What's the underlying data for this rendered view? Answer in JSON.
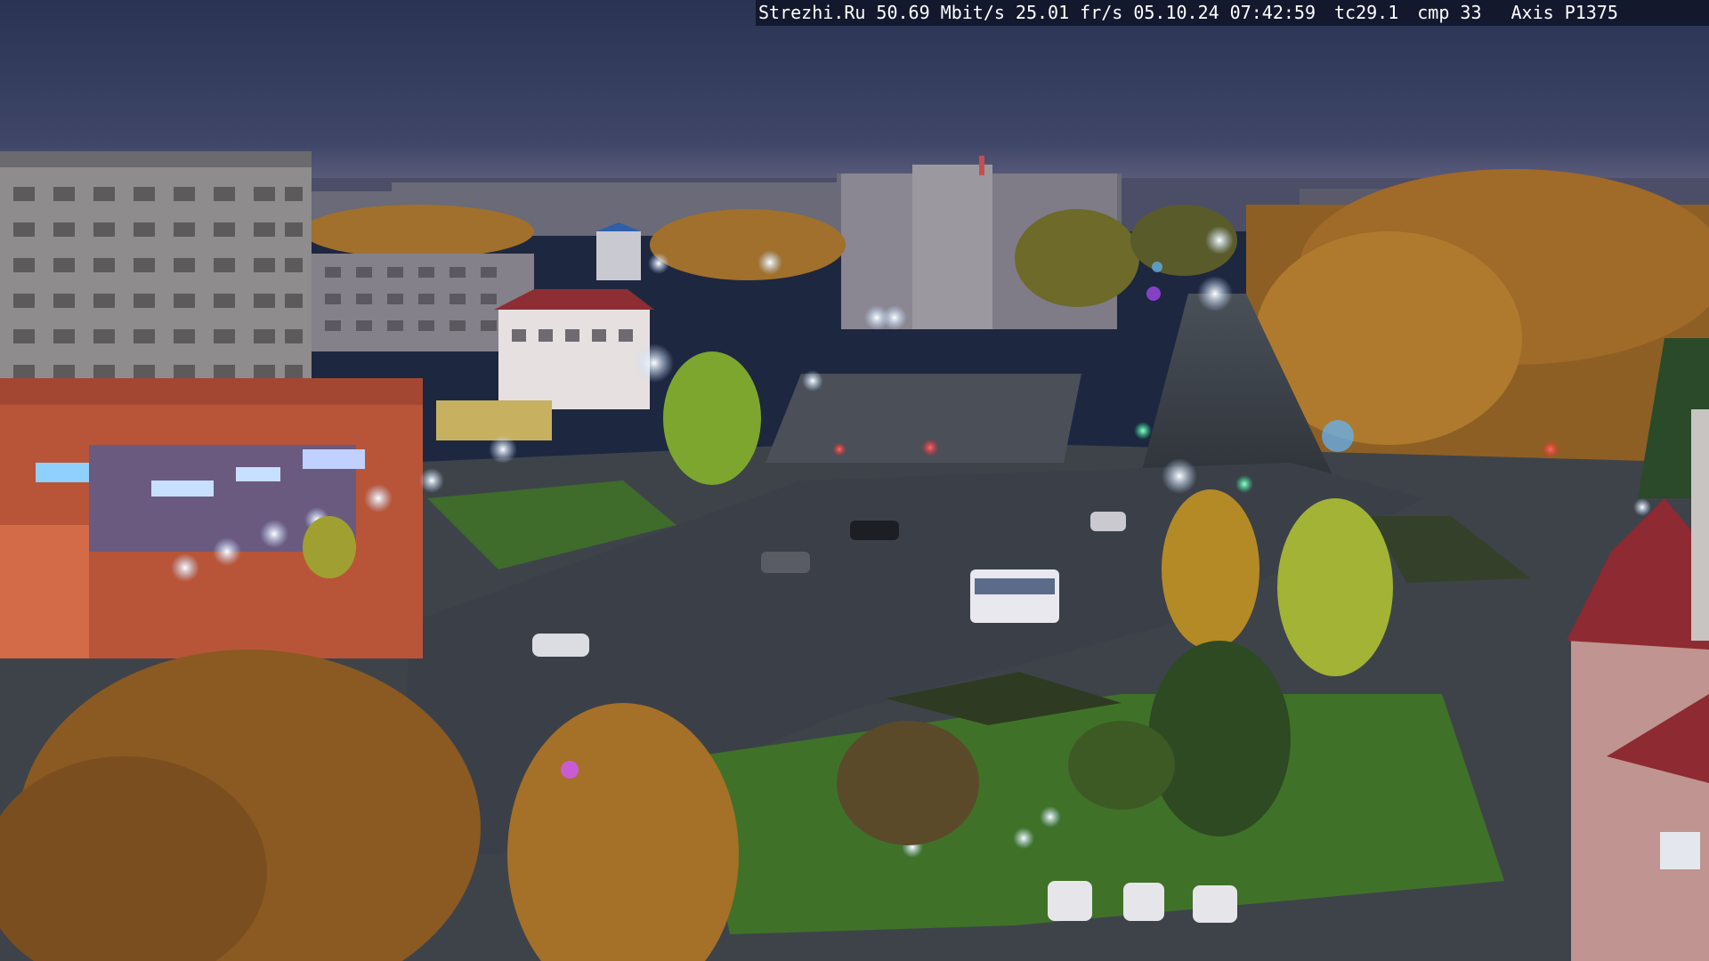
{
  "overlay": {
    "site": "Strezhi.Ru",
    "bitrate": "50.69 Mbit/s",
    "framerate": "25.01 fr/s",
    "date": "05.10.24",
    "time": "07:42:59",
    "tc": "tc29.1",
    "cmp": "cmp 33",
    "camera": "Axis P1375"
  },
  "scene": {
    "sky_color": "#2b3553",
    "horizon_color": "#6b6685",
    "foliage_color": "#b97a2a",
    "lawn_color": "#4f7a2e",
    "road_color": "#3a3f47",
    "store_color": "#c0553a",
    "light_color": "#e8f3ff"
  }
}
